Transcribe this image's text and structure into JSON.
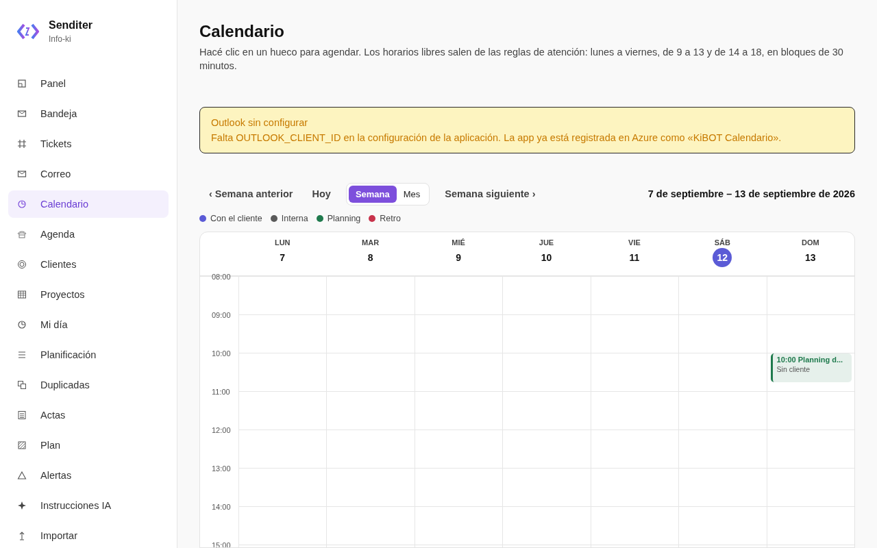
{
  "brand": {
    "name": "Senditer",
    "subtitle": "Info-ki"
  },
  "sidebar": {
    "items": [
      {
        "label": "Panel",
        "selected": false
      },
      {
        "label": "Bandeja",
        "selected": false
      },
      {
        "label": "Tickets",
        "selected": false
      },
      {
        "label": "Correo",
        "selected": false
      },
      {
        "label": "Calendario",
        "selected": true
      },
      {
        "label": "Agenda",
        "selected": false
      },
      {
        "label": "Clientes",
        "selected": false
      },
      {
        "label": "Proyectos",
        "selected": false
      },
      {
        "label": "Mi día",
        "selected": false
      },
      {
        "label": "Planificación",
        "selected": false
      },
      {
        "label": "Duplicadas",
        "selected": false
      },
      {
        "label": "Actas",
        "selected": false
      },
      {
        "label": "Plan",
        "selected": false
      },
      {
        "label": "Alertas",
        "selected": false
      },
      {
        "label": "Instrucciones IA",
        "selected": false
      },
      {
        "label": "Importar",
        "selected": false
      }
    ]
  },
  "page": {
    "title": "Calendario",
    "description": "Hacé clic en un hueco para agendar. Los horarios libres salen de las reglas de atención: lunes a viernes, de 9 a 13 y de 14 a 18, en bloques de 30 minutos."
  },
  "alert": {
    "title": "Outlook sin configurar",
    "message": "Falta OUTLOOK_CLIENT_ID en la configuración de la aplicación. La app ya está registrada en Azure como «KiBOT Calendario»."
  },
  "toolbar": {
    "previous": "‹ Semana anterior",
    "today": "Hoy",
    "views": [
      {
        "label": "Semana",
        "selected": true
      },
      {
        "label": "Mes",
        "selected": false
      }
    ],
    "next": "Semana siguiente ›",
    "range": "7 de septiembre – 13 de septiembre de 2026"
  },
  "legend": [
    {
      "label": "Con el cliente",
      "color": "#5b5bd6"
    },
    {
      "label": "Interna",
      "color": "#5a5a5a"
    },
    {
      "label": "Planning",
      "color": "#1f7a4d"
    },
    {
      "label": "Retro",
      "color": "#c8324b"
    }
  ],
  "calendar": {
    "days": [
      {
        "weekday": "LUN",
        "date": "7",
        "today": false
      },
      {
        "weekday": "MAR",
        "date": "8",
        "today": false
      },
      {
        "weekday": "MIÉ",
        "date": "9",
        "today": false
      },
      {
        "weekday": "JUE",
        "date": "10",
        "today": false
      },
      {
        "weekday": "VIE",
        "date": "11",
        "today": false
      },
      {
        "weekday": "SÁB",
        "date": "12",
        "today": true
      },
      {
        "weekday": "DOM",
        "date": "13",
        "today": false,
        "events": [
          {
            "start": "10:00",
            "title": "Planning d...",
            "client": "Sin cliente",
            "color": "#1f7a4d"
          }
        ]
      }
    ],
    "hours": [
      "08:00",
      "09:00",
      "10:00",
      "11:00",
      "12:00",
      "13:00",
      "14:00",
      "15:00"
    ]
  }
}
